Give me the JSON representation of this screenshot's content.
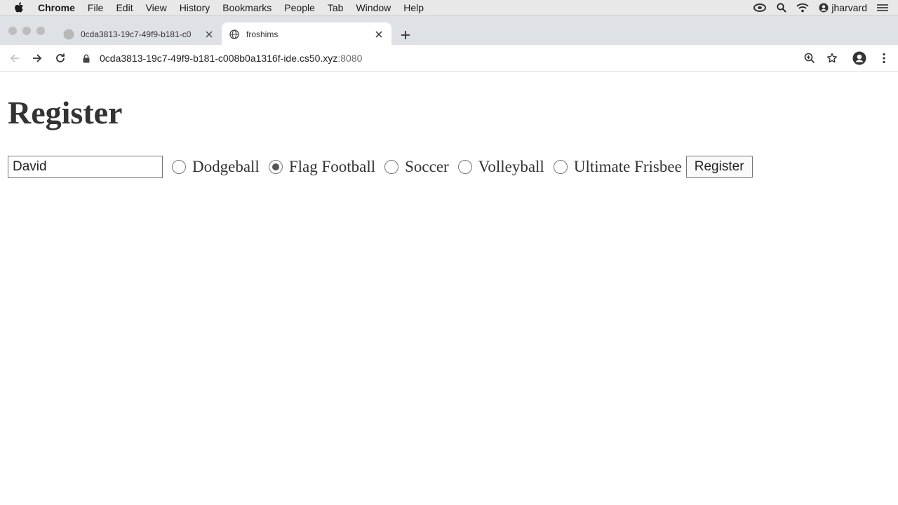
{
  "menubar": {
    "app": "Chrome",
    "items": [
      "File",
      "Edit",
      "View",
      "History",
      "Bookmarks",
      "People",
      "Tab",
      "Window",
      "Help"
    ],
    "user": "jharvard"
  },
  "tabs": [
    {
      "title": "0cda3813-19c7-49f9-b181-c0",
      "active": false
    },
    {
      "title": "froshims",
      "active": true
    }
  ],
  "address": {
    "host": "0cda3813-19c7-49f9-b181-c008b0a1316f-ide.cs50.xyz",
    "port": ":8080"
  },
  "page": {
    "title": "Register",
    "name_value": "David",
    "sports": [
      {
        "label": "Dodgeball",
        "checked": false
      },
      {
        "label": "Flag Football",
        "checked": true
      },
      {
        "label": "Soccer",
        "checked": false
      },
      {
        "label": "Volleyball",
        "checked": false
      },
      {
        "label": "Ultimate Frisbee",
        "checked": false
      }
    ],
    "submit_label": "Register"
  }
}
